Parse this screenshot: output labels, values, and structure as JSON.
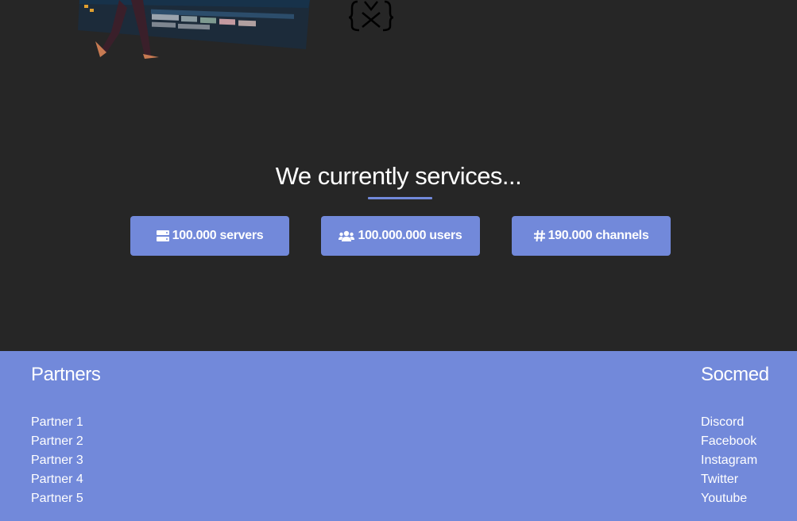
{
  "services": {
    "heading": "We currently services...",
    "stats": [
      {
        "icon": "server-icon",
        "label": "100.000 servers"
      },
      {
        "icon": "users-icon",
        "label": "100.000.000 users"
      },
      {
        "icon": "hashtag-icon",
        "label": "190.000 channels"
      }
    ]
  },
  "footer": {
    "partners": {
      "title": "Partners",
      "items": [
        "Partner 1",
        "Partner 2",
        "Partner 3",
        "Partner 4",
        "Partner 5"
      ]
    },
    "socmed": {
      "title": "Socmed",
      "items": [
        "Discord",
        "Facebook",
        "Instagram",
        "Twitter",
        "Youtube"
      ]
    }
  },
  "colors": {
    "background": "#262626",
    "accent": "#7289da",
    "text": "#ffffff"
  }
}
